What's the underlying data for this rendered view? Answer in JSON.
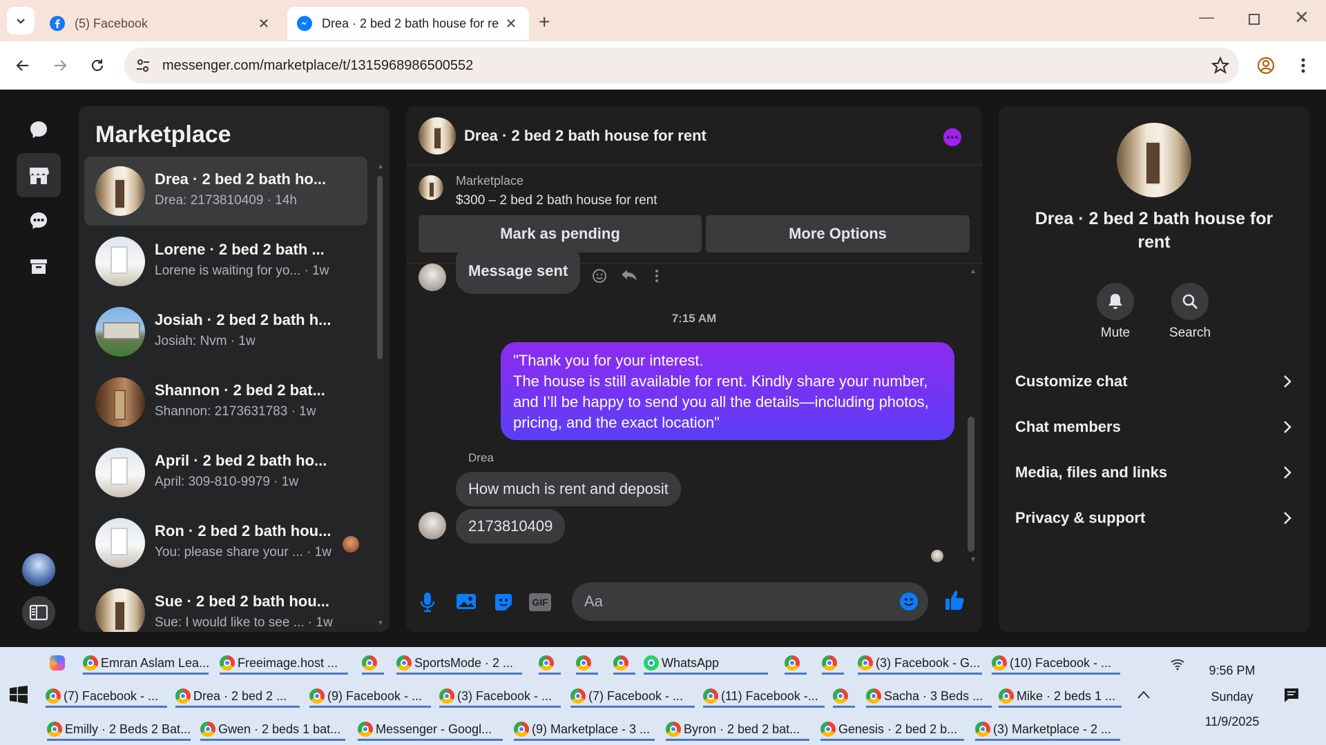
{
  "browser": {
    "tabs": [
      {
        "title": "(5) Facebook",
        "icon": "facebook-icon",
        "active": false
      },
      {
        "title": "Drea · 2 bed 2 bath house for re",
        "icon": "messenger-icon",
        "active": true
      }
    ],
    "url": "messenger.com/marketplace/t/1315968986500552"
  },
  "rail": {
    "items": [
      "chats-icon",
      "marketplace-icon",
      "requests-icon",
      "archive-icon"
    ],
    "active_index": 1
  },
  "chatlist": {
    "title": "Marketplace",
    "conversations": [
      {
        "name": "Drea · 2 bed 2 bath ho...",
        "sub": "Drea: 2173810409 · 14h",
        "active": true,
        "photo": "a"
      },
      {
        "name": "Lorene · 2 bed 2 bath ...",
        "sub": "Lorene is waiting for yo... · 1w",
        "photo": "b"
      },
      {
        "name": "Josiah · 2 bed 2 bath h...",
        "sub": "Josiah: Nvm · 1w",
        "photo": "c"
      },
      {
        "name": "Shannon · 2 bed 2 bat...",
        "sub": "Shannon: 2173631783 · 1w",
        "photo": "d"
      },
      {
        "name": "April · 2 bed 2 bath ho...",
        "sub": "April: 309-810-9979 · 1w",
        "photo": "b"
      },
      {
        "name": "Ron · 2 bed 2 bath hou...",
        "sub": "You: please share your ...  · 1w",
        "photo": "b"
      },
      {
        "name": "Sue · 2 bed 2 bath hou...",
        "sub": "Sue: I would like to see ... · 1w",
        "photo": "a"
      }
    ]
  },
  "chat": {
    "title": "Drea · 2 bed 2 bath house for rent",
    "listing": {
      "source": "Marketplace",
      "summary": "$300 – 2 bed 2 bath house for rent"
    },
    "buttons": {
      "pending": "Mark as pending",
      "more": "More Options"
    },
    "partial_message": "Message sent",
    "time_divider": "7:15 AM",
    "outgoing": [
      "\"Thank you for your interest.",
      "The house is still available for rent. Kindly share your number,",
      "and I’ll be happy to send you all the details—including photos,",
      "pricing, and the exact location\""
    ],
    "sender_label": "Drea",
    "incoming": [
      "How much is rent and deposit",
      "2173810409"
    ],
    "composer_placeholder": "Aa"
  },
  "info": {
    "title_line1": "Drea · 2 bed 2 bath house for",
    "title_line2": "rent",
    "mute": "Mute",
    "search": "Search",
    "rows": [
      "Customize chat",
      "Chat members",
      "Media, files and links",
      "Privacy & support"
    ]
  },
  "taskbar": {
    "row1": [
      "Emran Aslam Lea...",
      "Freeimage.host ...",
      "",
      "SportsMode · 2 ...",
      "",
      "",
      "",
      "WhatsApp",
      "",
      "",
      "(3) Facebook - G...",
      "(10) Facebook - ..."
    ],
    "row2": [
      "(7) Facebook - ...",
      "Drea · 2 bed 2 ...",
      "(9) Facebook - ...",
      "(3) Facebook - ...",
      "(7) Facebook - ...",
      "(11) Facebook -...",
      "",
      "Sacha · 3 Beds ...",
      "Mike · 2 beds 1 ..."
    ],
    "row3": [
      "Emilly · 2 Beds 2 Bat...",
      "Gwen · 2 beds 1 bat...",
      "Messenger - Googl...",
      "(9) Marketplace - 3 ...",
      "Byron · 2 bed 2 bat...",
      "Genesis · 2 bed 2 b...",
      "(3) Marketplace - 2 ..."
    ],
    "time": "9:56 PM",
    "day": "Sunday",
    "date": "11/9/2025"
  },
  "colors": {
    "accent_purple": "#7b2ff7",
    "messenger_blue": "#0a7cff",
    "dark_bg": "#161616"
  }
}
